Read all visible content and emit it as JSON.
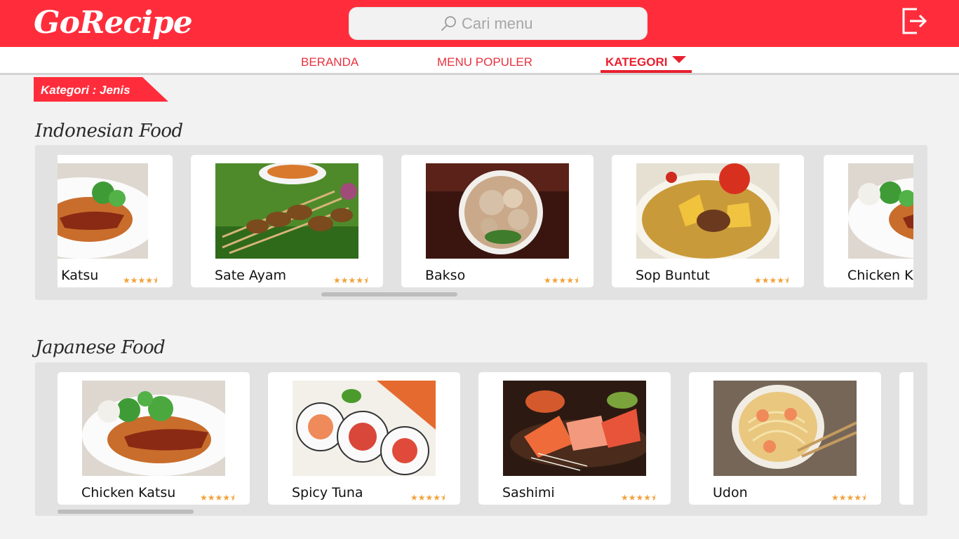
{
  "app": {
    "logo": "GoRecipe",
    "brand_color": "#ff2d3b"
  },
  "search": {
    "placeholder": "Cari menu",
    "value": ""
  },
  "nav": {
    "items": [
      {
        "label": "BERANDA",
        "active": false
      },
      {
        "label": "MENU POPULER",
        "active": false
      },
      {
        "label": "KATEGORI",
        "active": true
      }
    ]
  },
  "category_tag": "Kategori : Jenis",
  "sections": [
    {
      "title": "Indonesian Food",
      "cards": [
        {
          "name": "Chicken Katsu",
          "rating": 4.5,
          "stars": "★★★★⯨",
          "image": "chicken-katsu"
        },
        {
          "name": "Sate Ayam",
          "rating": 4.5,
          "stars": "★★★★⯨",
          "image": "sate-ayam"
        },
        {
          "name": "Bakso",
          "rating": 4.5,
          "stars": "★★★★⯨",
          "image": "bakso"
        },
        {
          "name": "Sop Buntut",
          "rating": 4.5,
          "stars": "★★★★⯨",
          "image": "sop-buntut"
        },
        {
          "name": "Chicken Katsu",
          "rating": 4.5,
          "stars": "★★★★⯨",
          "image": "chicken-katsu"
        }
      ]
    },
    {
      "title": "Japanese Food",
      "cards": [
        {
          "name": "Chicken Katsu",
          "rating": 4.5,
          "stars": "★★★★⯨",
          "image": "chicken-katsu"
        },
        {
          "name": "Spicy Tuna",
          "rating": 4.5,
          "stars": "★★★★⯨",
          "image": "spicy-tuna"
        },
        {
          "name": "Sashimi",
          "rating": 4.5,
          "stars": "★★★★⯨",
          "image": "sashimi"
        },
        {
          "name": "Udon",
          "rating": 4.5,
          "stars": "★★★★⯨",
          "image": "udon"
        }
      ]
    }
  ],
  "icons": {
    "search": "search-icon",
    "logout": "logout-icon"
  }
}
